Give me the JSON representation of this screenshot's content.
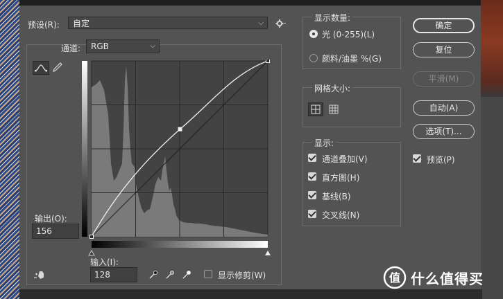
{
  "preset": {
    "label": "预设(R):",
    "value": "自定"
  },
  "channel": {
    "label": "通道:",
    "value": "RGB"
  },
  "output": {
    "label": "输出(O):",
    "value": "156"
  },
  "input": {
    "label": "输入(I):",
    "value": "128"
  },
  "show_clipping": {
    "label": "显示修剪(W)",
    "checked": false
  },
  "display_amount": {
    "title": "显示数量:",
    "options": [
      {
        "label": "光 (0-255)(L)",
        "selected": true
      },
      {
        "label": "颜料/油墨 %(G)",
        "selected": false
      }
    ]
  },
  "grid_size": {
    "title": "网格大小:"
  },
  "show": {
    "title": "显示:",
    "items": [
      {
        "label": "通道叠加(V)",
        "checked": true
      },
      {
        "label": "直方图(H)",
        "checked": true
      },
      {
        "label": "基线(B)",
        "checked": true
      },
      {
        "label": "交叉线(N)",
        "checked": true
      }
    ]
  },
  "buttons": {
    "ok": "确定",
    "reset": "复位",
    "smooth": "平滑(M)",
    "auto": "自动(A)",
    "options": "选项(T)..."
  },
  "preview": {
    "label": "预览(P)",
    "checked": true
  },
  "watermark": {
    "text": "什么值得买"
  },
  "curve": {
    "points": [
      [
        0,
        0
      ],
      [
        128,
        156
      ],
      [
        255,
        255
      ]
    ]
  }
}
